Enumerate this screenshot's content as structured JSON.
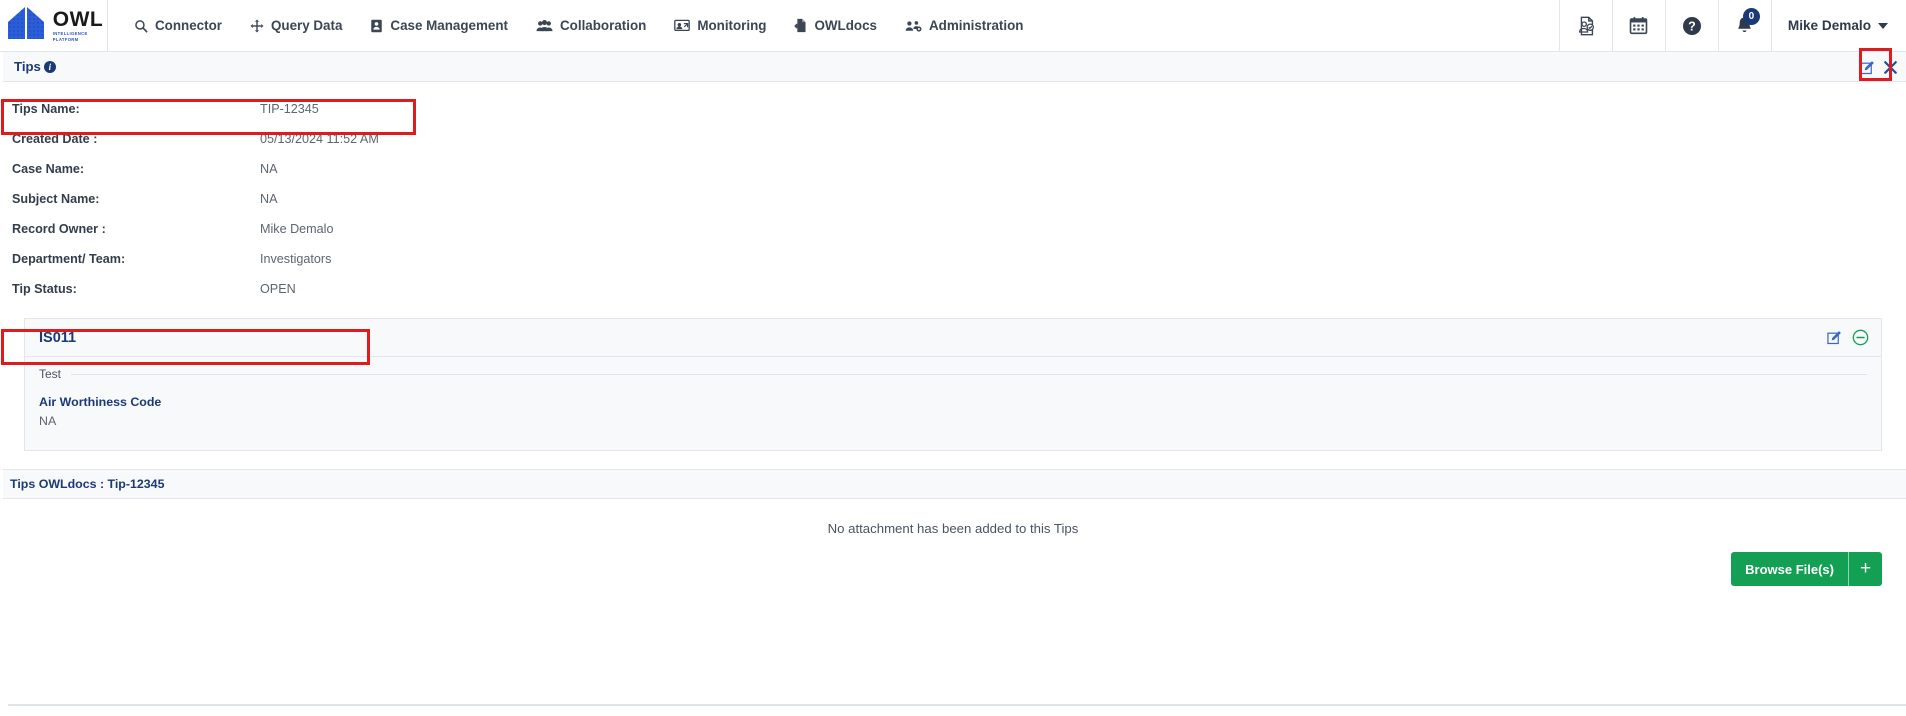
{
  "brand": {
    "name": "OWL",
    "tagline_line1": "INTELLIGENCE",
    "tagline_line2": "PLATFORM"
  },
  "nav": {
    "items": [
      {
        "label": "Connector",
        "icon": "search-icon"
      },
      {
        "label": "Query Data",
        "icon": "move-arrows-icon"
      },
      {
        "label": "Case Management",
        "icon": "id-card-icon"
      },
      {
        "label": "Collaboration",
        "icon": "users-icon"
      },
      {
        "label": "Monitoring",
        "icon": "monitor-user-icon"
      },
      {
        "label": "OWLdocs",
        "icon": "file-upload-icon"
      },
      {
        "label": "Administration",
        "icon": "admin-gear-users-icon"
      }
    ],
    "right_icons": [
      {
        "name": "audit-report-icon"
      },
      {
        "name": "calendar-icon"
      },
      {
        "name": "help-circle-icon"
      },
      {
        "name": "notification-bell-icon",
        "badge": "0"
      }
    ],
    "user": {
      "name": "Mike Demalo"
    }
  },
  "tips_bar": {
    "title": "Tips",
    "info_icon": "info-circle-icon",
    "edit_icon": "edit-pencil-icon",
    "close_icon": "close-x-icon"
  },
  "details": {
    "fields": [
      {
        "label": "Tips Name:",
        "value": "TIP-12345",
        "highlighted": true
      },
      {
        "label": "Created Date :",
        "value": "05/13/2024 11:52 AM",
        "highlighted": false
      },
      {
        "label": "Case Name:",
        "value": "NA",
        "highlighted": false
      },
      {
        "label": "Subject Name:",
        "value": "NA",
        "highlighted": false
      },
      {
        "label": "Record Owner :",
        "value": "Mike Demalo",
        "highlighted": false
      },
      {
        "label": "Department/ Team:",
        "value": "Investigators",
        "highlighted": false
      },
      {
        "label": "Tip Status:",
        "value": "OPEN",
        "highlighted": true
      }
    ]
  },
  "card": {
    "title": "IS011",
    "legend": "Test",
    "edit_icon": "edit-pencil-icon",
    "remove_icon": "minus-circle-icon",
    "attributes": [
      {
        "name": "Air Worthiness Code",
        "value": "NA"
      }
    ]
  },
  "docs": {
    "title": "Tips OWLdocs : Tip-12345",
    "empty_message": "No attachment has been added to this Tips",
    "browse_label": "Browse File(s)",
    "plus_label": "+"
  },
  "colors": {
    "brand_blue": "#2b56b5",
    "nav_text": "#3c4655",
    "heading_blue": "#1b3a73",
    "annotation_red": "#e01b1b",
    "button_green": "#13a055",
    "panel_bg": "#f7f9fb",
    "border": "#e3e6ec"
  }
}
